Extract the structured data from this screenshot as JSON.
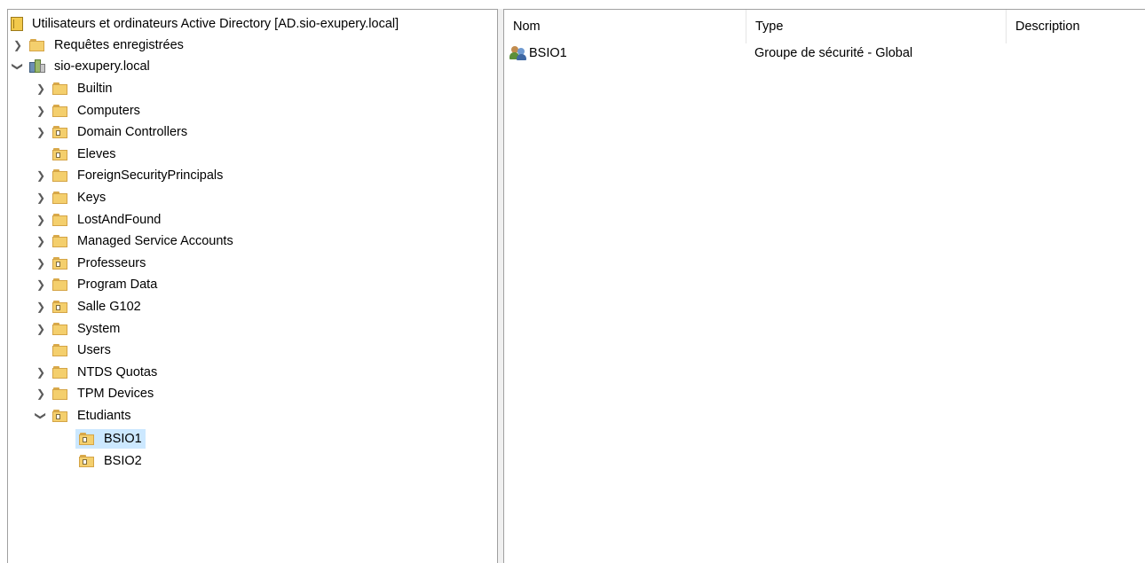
{
  "tree": {
    "root": "Utilisateurs et ordinateurs Active Directory [AD.sio-exupery.local]",
    "saved_queries": "Requêtes enregistrées",
    "domain": "sio-exupery.local",
    "items": [
      {
        "label": "Builtin",
        "ou": false
      },
      {
        "label": "Computers",
        "ou": false
      },
      {
        "label": "Domain Controllers",
        "ou": true
      },
      {
        "label": "Eleves",
        "ou": true
      },
      {
        "label": "ForeignSecurityPrincipals",
        "ou": false
      },
      {
        "label": "Keys",
        "ou": false
      },
      {
        "label": "LostAndFound",
        "ou": false
      },
      {
        "label": "Managed Service Accounts",
        "ou": false
      },
      {
        "label": "Professeurs",
        "ou": true
      },
      {
        "label": "Program Data",
        "ou": false
      },
      {
        "label": "Salle G102",
        "ou": true
      },
      {
        "label": "System",
        "ou": false
      },
      {
        "label": "Users",
        "ou": false
      },
      {
        "label": "NTDS Quotas",
        "ou": false
      },
      {
        "label": "TPM Devices",
        "ou": false
      },
      {
        "label": "Etudiants",
        "ou": true
      }
    ],
    "children": [
      {
        "label": "BSIO1",
        "selected": true
      },
      {
        "label": "BSIO2",
        "selected": false
      }
    ]
  },
  "list": {
    "columns": {
      "name": "Nom",
      "type": "Type",
      "description": "Description"
    },
    "rows": [
      {
        "name": "BSIO1",
        "type": "Groupe de sécurité - Global",
        "description": ""
      }
    ]
  },
  "colors": {
    "selection": "#cce8ff",
    "border": "#a0a0a0"
  }
}
